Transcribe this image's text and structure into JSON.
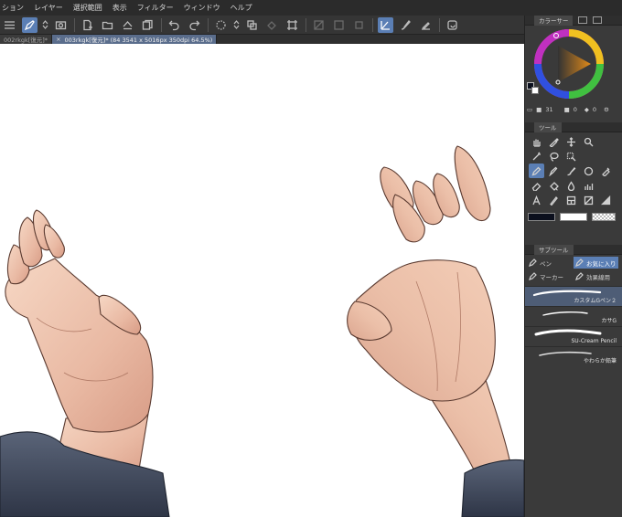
{
  "menubar": {
    "items": [
      "ション",
      "レイヤー",
      "選択範囲",
      "表示",
      "フィルター",
      "ウィンドウ",
      "ヘルプ"
    ]
  },
  "toolbar": {
    "icons": [
      "menu-icon",
      "pen-icon",
      "stepper-icon",
      "camera-icon",
      "new-file-icon",
      "open-icon",
      "save-icon",
      "copy-icon",
      "undo-icon",
      "redo-icon",
      "spinner-icon",
      "transform-icon",
      "crop-icon",
      "clear-icon",
      "fill-icon",
      "square-icon",
      "pen-pressure-icon",
      "brush-icon",
      "ruler-icon",
      "rotate-icon"
    ]
  },
  "tabs": [
    {
      "label": "002rkgk[復元]*",
      "active": false
    },
    {
      "label": "003rkgk[復元]* (84 3541 x 5016px 350dpi 64.5%)",
      "active": true
    }
  ],
  "color_panel": {
    "title": "カラーサー",
    "values": [
      "31",
      "0",
      "0"
    ],
    "main_color": "#0b0f1d",
    "sub_color": "#ffffff"
  },
  "tool_panel": {
    "title": "ツール"
  },
  "subtool_panel": {
    "title": "サブツール",
    "tabs": [
      {
        "label": "ペン",
        "active": false
      },
      {
        "label": "お気に入り",
        "active": true
      },
      {
        "label": "マーカー",
        "active": false
      },
      {
        "label": "効果線用",
        "active": false
      }
    ],
    "brushes": [
      {
        "name": "カスタムGペン２",
        "active": true
      },
      {
        "name": "カサG",
        "active": false
      },
      {
        "name": "SU-Cream Pencil",
        "active": false
      },
      {
        "name": "やわらか鉛筆",
        "active": false
      }
    ]
  },
  "colors": {
    "accent": "#5b7fb5",
    "panel_bg": "#3a3a3a",
    "canvas_bg": "#ffffff"
  }
}
